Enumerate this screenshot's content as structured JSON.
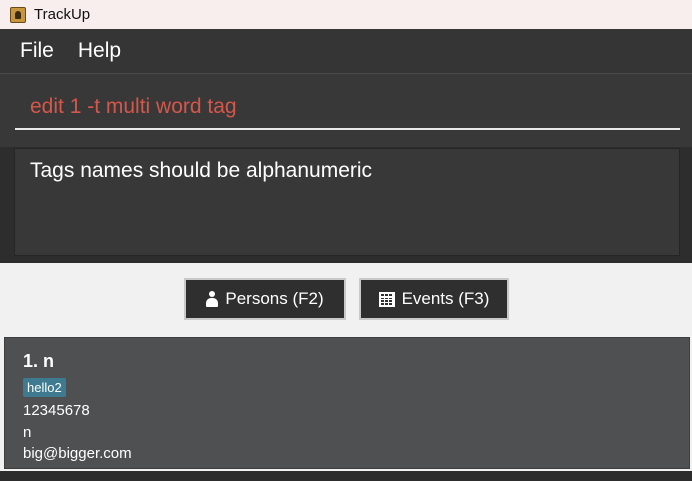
{
  "window": {
    "title": "TrackUp",
    "icon": "app-icon"
  },
  "menu": {
    "items": [
      "File",
      "Help"
    ]
  },
  "command": {
    "value": "edit 1 -t multi word tag"
  },
  "result": {
    "message": "Tags names should be alphanumeric"
  },
  "tabs": [
    {
      "label": "Persons (F2)",
      "icon": "person-icon"
    },
    {
      "label": "Events (F3)",
      "icon": "calendar-icon"
    }
  ],
  "persons": [
    {
      "name": "1. n",
      "tag": "hello2",
      "phone": "12345678",
      "address": "n",
      "email": "big@bigger.com"
    }
  ],
  "colors": {
    "title_bar": "#f9eeee",
    "menu_bar": "#353535",
    "command_text_error": "#d5574a",
    "panel": "#383838",
    "card": "#4f5052",
    "tag": "#3e7b91"
  }
}
